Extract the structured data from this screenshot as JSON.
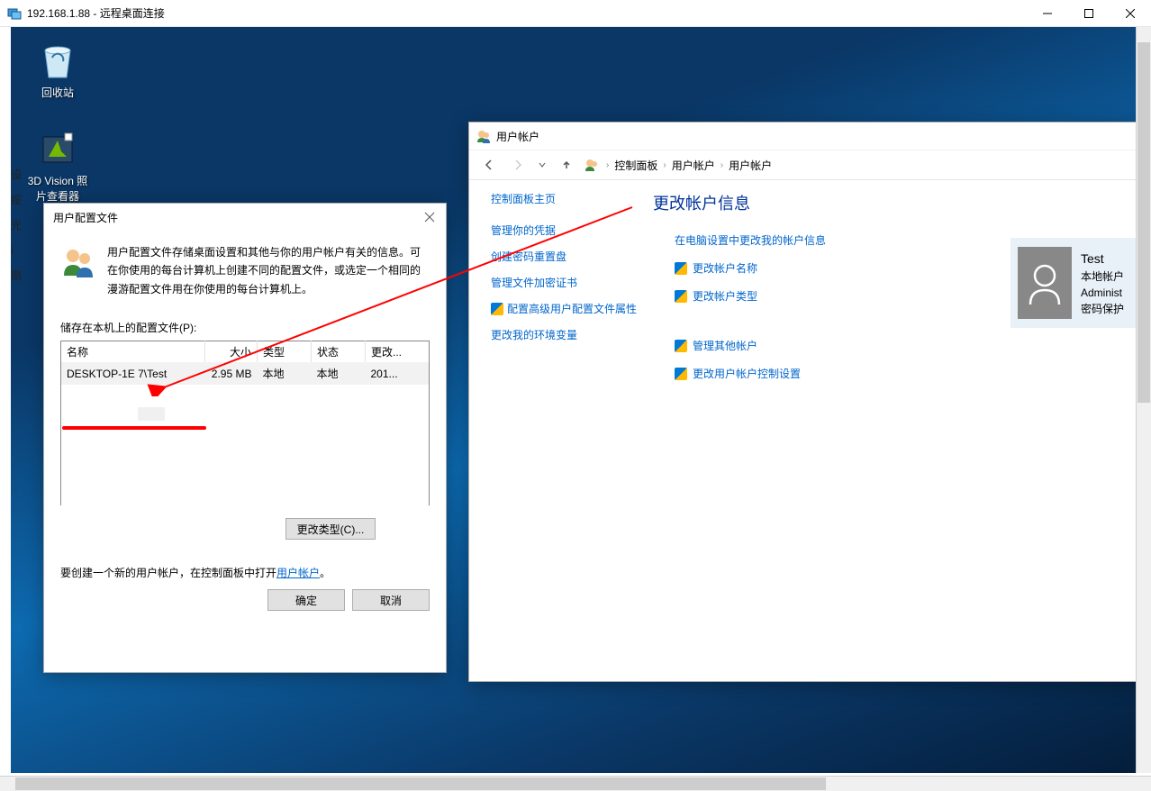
{
  "rdp": {
    "title": "192.168.1.88 - 远程桌面连接"
  },
  "desktop": {
    "recycle": "回收站",
    "viewer": "3D Vision 照片查看器"
  },
  "dialog": {
    "title": "用户配置文件",
    "intro": "用户配置文件存储桌面设置和其他与你的用户帐户有关的信息。可在你使用的每台计算机上创建不同的配置文件，或选定一个相同的漫游配置文件用在你使用的每台计算机上。",
    "list_label": "储存在本机上的配置文件(P):",
    "cols": {
      "name": "名称",
      "size": "大小",
      "type": "类型",
      "state": "状态",
      "chg": "更改..."
    },
    "row": {
      "name": "DESKTOP-1E        7\\Test",
      "size": "2.95 MB",
      "type": "本地",
      "state": "本地",
      "chg": "201..."
    },
    "change_type": "更改类型(C)...",
    "create_prefix": "要创建一个新的用户帐户，在控制面板中打开",
    "create_link": "用户帐户",
    "create_suffix": "。",
    "ok": "确定",
    "cancel": "取消"
  },
  "cp": {
    "title": "用户帐户",
    "crumbs": [
      "控制面板",
      "用户帐户",
      "用户帐户"
    ],
    "side": {
      "home": "控制面板主页",
      "items": [
        {
          "label": "管理你的凭据",
          "shield": false
        },
        {
          "label": "创建密码重置盘",
          "shield": false
        },
        {
          "label": "管理文件加密证书",
          "shield": false
        },
        {
          "label": "配置高级用户配置文件属性",
          "shield": true
        },
        {
          "label": "更改我的环境变量",
          "shield": false
        }
      ]
    },
    "main": {
      "heading": "更改帐户信息",
      "links": [
        {
          "label": "在电脑设置中更改我的帐户信息",
          "shield": false
        },
        {
          "label": "更改帐户名称",
          "shield": true
        },
        {
          "label": "更改帐户类型",
          "shield": true
        }
      ],
      "links2": [
        {
          "label": "管理其他帐户",
          "shield": true
        },
        {
          "label": "更改用户帐户控制设置",
          "shield": true
        }
      ]
    },
    "user": {
      "name": "Test",
      "type": "本地帐户",
      "role": "Administ",
      "pw": "密码保护"
    }
  }
}
